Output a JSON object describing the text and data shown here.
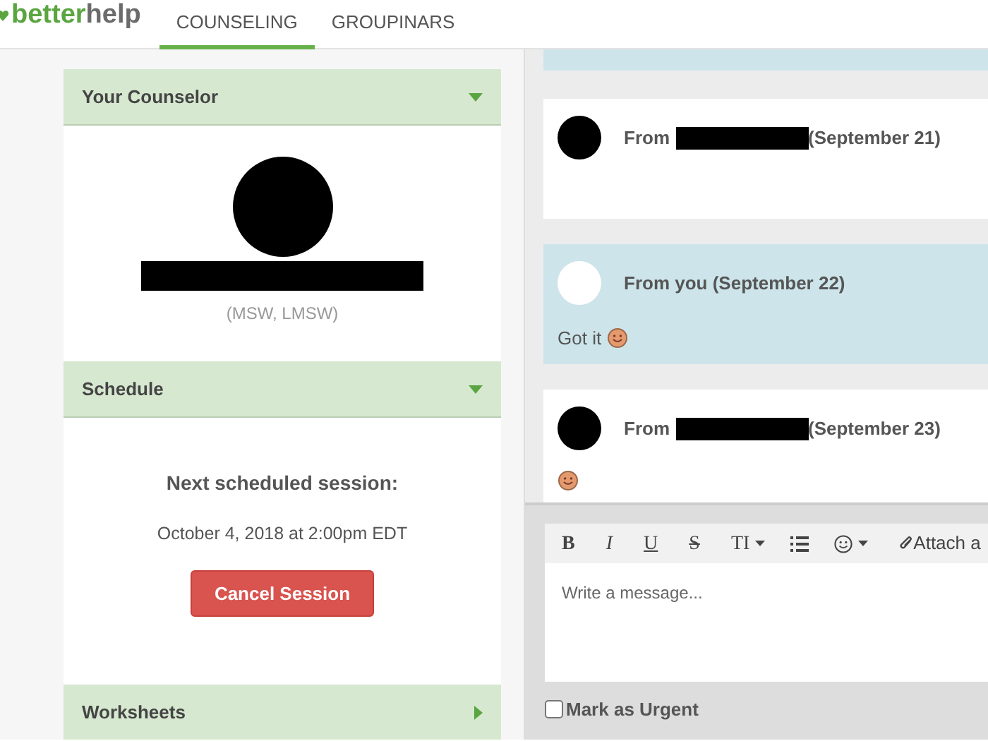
{
  "header": {
    "logo": {
      "part_1": "better",
      "part_2": "help"
    },
    "tabs": [
      {
        "label": "COUNSELING",
        "selected": true
      },
      {
        "label": "GROUPINARS",
        "selected": false
      }
    ]
  },
  "sidebar": [
    {
      "kind": "counselor",
      "title": "Your Counselor",
      "expanded": true,
      "credentials": "(MSW, LMSW)"
    },
    {
      "kind": "schedule",
      "title": "Schedule",
      "expanded": true,
      "heading": "Next scheduled session:",
      "when": "October 4, 2018 at 2:00pm EDT",
      "button": "Cancel Session"
    },
    {
      "title": "Worksheets",
      "expanded": false
    }
  ],
  "messages": [
    {
      "kind": "incoming",
      "prefix": "From",
      "date": "(September 21)",
      "emoji": false
    },
    {
      "kind": "outgoing",
      "prefix": "From you (September 22)",
      "text": "Got it",
      "emoji": true
    },
    {
      "kind": "incoming",
      "prefix": "From",
      "date": "(September 23)",
      "emoji": true
    }
  ],
  "composer": {
    "toolbar": [
      {
        "kind": "bold",
        "label": "B"
      },
      {
        "kind": "italic",
        "label": "I"
      },
      {
        "kind": "underline",
        "label": "U"
      },
      {
        "kind": "strike",
        "label": "S"
      },
      {
        "kind": "text-size",
        "label": "TI"
      },
      {
        "kind": "list"
      },
      {
        "kind": "emoji"
      },
      {
        "kind": "attach",
        "label": "Attach a"
      }
    ],
    "placeholder": "Write a message...",
    "urgent": {
      "label": "Mark as Urgent",
      "checked": false
    }
  }
}
